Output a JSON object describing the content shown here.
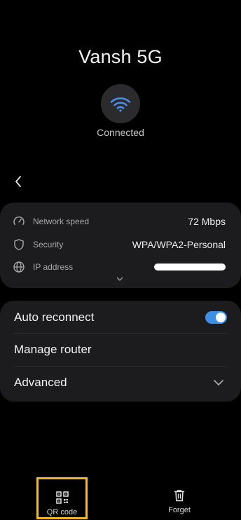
{
  "network": {
    "name": "Vansh 5G",
    "status": "Connected"
  },
  "details": {
    "speed": {
      "label": "Network speed",
      "value": "72 Mbps",
      "icon": "speedometer-icon"
    },
    "security": {
      "label": "Security",
      "value": "WPA/WPA2-Personal",
      "icon": "shield-icon"
    },
    "ip": {
      "label": "IP address",
      "value": "",
      "icon": "globe-icon"
    }
  },
  "settings": {
    "auto_reconnect": {
      "label": "Auto reconnect",
      "enabled": true
    },
    "manage_router": {
      "label": "Manage router"
    },
    "advanced": {
      "label": "Advanced"
    }
  },
  "bottom_bar": {
    "qr_code": "QR code",
    "forget": "Forget"
  },
  "colors": {
    "accent": "#3e8fe6",
    "highlight_border": "#f1b92b",
    "card_bg": "#1c1c1e"
  }
}
